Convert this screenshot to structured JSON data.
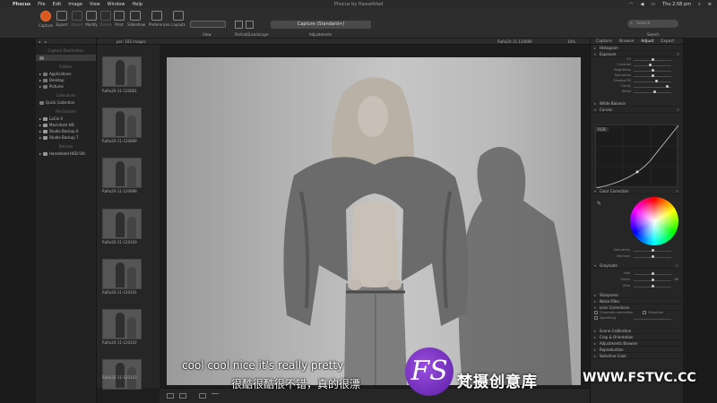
{
  "menubar": {
    "app_name": "Phocus",
    "menus": [
      "File",
      "Edit",
      "Image",
      "View",
      "Window",
      "Help"
    ],
    "window_title": "Phocus by Hasselblad",
    "clock": "Thu 2:58 pm"
  },
  "toolbar": {
    "buttons": [
      {
        "label": "Capture"
      },
      {
        "label": "Export"
      },
      {
        "label": "Import"
      },
      {
        "label": "Modify"
      },
      {
        "label": "Delete"
      },
      {
        "label": "Print"
      },
      {
        "label": "Slideshow"
      },
      {
        "label": "Preferences"
      },
      {
        "label": "Layouts"
      }
    ],
    "view_label": "View",
    "portrait_landscape_label": "Portrait/Landscape",
    "adjustments_value": "Capture (Standard+)",
    "adjustments_label": "Adjustments",
    "search_placeholder": "Search",
    "search_label": "Search"
  },
  "left_panel": {
    "header": "Capture Destination",
    "folders_title": "Folders",
    "folders": [
      "Applications",
      "Desktop",
      "Pictures"
    ],
    "collections_title": "Collections",
    "collections": [
      "Quick Collection"
    ],
    "file_system_title": "File System",
    "disks": [
      "LaCie 4",
      "Macintosh HD",
      "Studio Backup 6",
      "Studio Backup 7"
    ],
    "devices_title": "Devices",
    "devices": [
      "Hasselblad H6D-50c"
    ]
  },
  "thumbs": {
    "header": "per: 103 images",
    "items": [
      "RaRa20-11-120081",
      "RaRa20-11-120089",
      "RaRa20-11-120098",
      "RaRa20-11-120100",
      "RaRa20-11-120101",
      "RaRa20-11-120102",
      "RaRa20-11-120103"
    ]
  },
  "viewer": {
    "filename": "RaRa20-11-120089",
    "zoom": "10%"
  },
  "right_panel": {
    "tabs": [
      "Capture",
      "Browse",
      "Adjust",
      "Export"
    ],
    "active_tab": "Adjust",
    "tools": {
      "histogram": "Histogram",
      "exposure": "Exposure",
      "white_balance": "White Balance",
      "curves": "Curves",
      "color_correction": "Color Correction",
      "grayscale": "Grayscale",
      "sharpness": "Sharpness",
      "noise_filter": "Noise Filter",
      "lens_corrections": "Lens Corrections",
      "scene_calibration": "Scene Calibration",
      "crop_orientation": "Crop & Orientation",
      "adjustments_browser": "Adjustments Browser",
      "reproduction": "Reproduction",
      "selective_color": "Selective Color"
    },
    "exposure_sliders": [
      "EV",
      "Contrast",
      "Brightness",
      "Saturation",
      "Shadow Fill",
      "Clarity",
      "Detail"
    ],
    "exposure_levels": [
      0.5,
      0.45,
      0.5,
      0.5,
      0.6,
      0.9,
      0.55
    ],
    "exposure_value": "0.00",
    "curves_channel": "RGB",
    "color_sliders": [
      "Saturation",
      "Vibrance"
    ],
    "grayscale_sliders": [
      "Red",
      "Green",
      "Blue"
    ],
    "grayscale_values": [
      "",
      "50",
      ""
    ],
    "lens_options": [
      "Chromatic aberration",
      "Distortion",
      "Vignetting"
    ]
  },
  "subtitles": {
    "english": "cool cool nice it's really pretty",
    "chinese": "很酷很酷很不错，真的很漂"
  },
  "watermark": {
    "logo": "FS",
    "brand_cn": "梵摄创意库",
    "url": "WWW.FSTVC.CC"
  }
}
